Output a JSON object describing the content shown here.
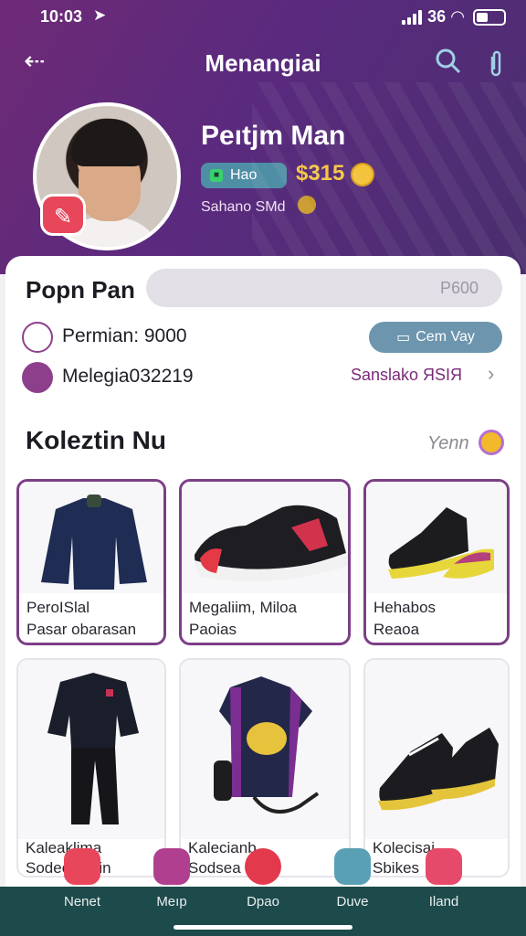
{
  "status_bar": {
    "time": "10:03",
    "signal": "36"
  },
  "nav": {
    "title": "Menangiai"
  },
  "icons": {
    "back": "back-arrow-icon",
    "search": "search-icon",
    "attach": "paperclip-icon"
  },
  "profile": {
    "name": "Peıtjm Man",
    "tag": "Hao",
    "price": "$315",
    "subtitle": "Sahano SMd"
  },
  "card": {
    "title": "Popn Pan",
    "search_placeholder": "P600",
    "payment_label": "Permian: 9000",
    "pay_button": "Cem Vay",
    "location_label": "Melegia032219",
    "location_link": "Sanslako ЯSIЯ"
  },
  "collection": {
    "title": "Koleztin Nu",
    "view_all": "Yenn",
    "items": [
      {
        "line1": "PeroISlal",
        "line2": "Pasar obarasan"
      },
      {
        "line1": "Megaliim, Miloa",
        "line2": "Paoias"
      },
      {
        "line1": "Hehabos",
        "line2": "Reaoa"
      },
      {
        "line1": "Kaleaklima",
        "line2": "Sodeo Perin"
      },
      {
        "line1": "Kalecianb",
        "line2": "Sodsea"
      },
      {
        "line1": "Kolecisai",
        "line2": "Sbikes"
      }
    ]
  },
  "tabs": [
    {
      "label": "Nenet",
      "color": "#e8465b"
    },
    {
      "label": "Meıp",
      "color": "#b0408f"
    },
    {
      "label": "Dpao",
      "color": "#e3394d"
    },
    {
      "label": "Duve",
      "color": "#5aa0b4"
    },
    {
      "label": "Iland",
      "color": "#e64a6a"
    }
  ]
}
